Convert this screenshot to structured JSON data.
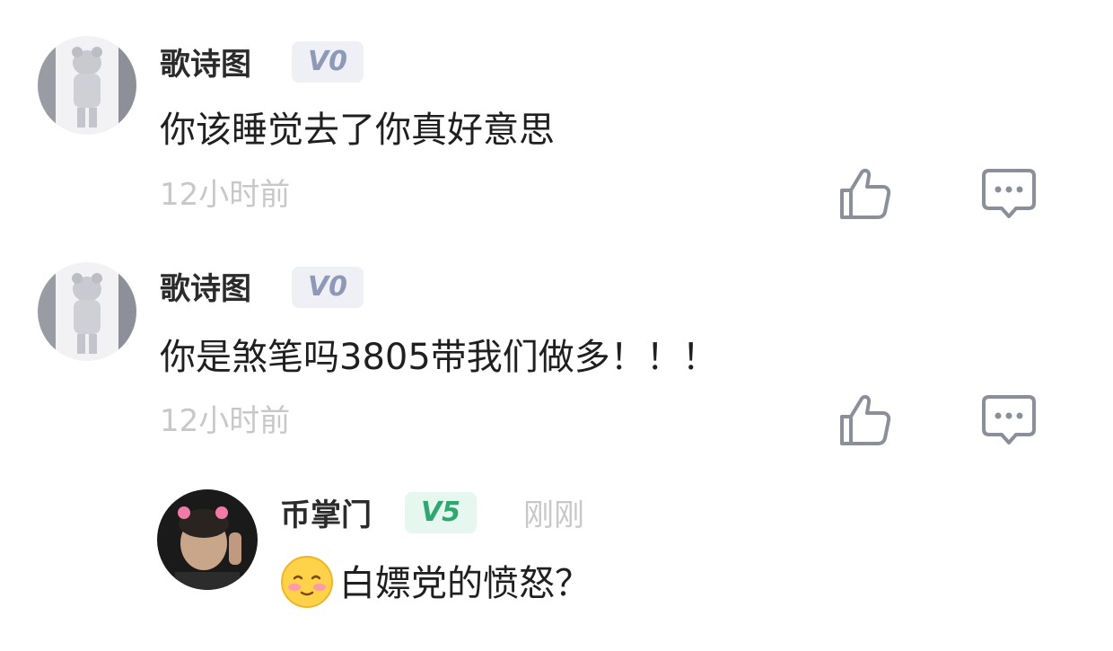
{
  "comments": [
    {
      "username": "歌诗图",
      "level": "V0",
      "text": "你该睡觉去了你真好意思",
      "time": "12小时前"
    },
    {
      "username": "歌诗图",
      "level": "V0",
      "text": "你是煞笔吗3805带我们做多！！！",
      "time": "12小时前"
    }
  ],
  "reply": {
    "username": "币掌门",
    "level": "V5",
    "time": "刚刚",
    "emoji_icon": "blushing-face-emoji",
    "text": "白嫖党的愤怒？"
  },
  "icons": {
    "like": "thumbs-up-icon",
    "reply": "comment-bubble-icon"
  },
  "colors": {
    "badge_v0_bg": "#eef0f5",
    "badge_v0_text": "#8e98b7",
    "badge_v5_bg": "#e6f7ef",
    "badge_v5_text": "#2ea86f",
    "timestamp": "#c8c8c8",
    "icon_stroke": "#8a8f99"
  }
}
